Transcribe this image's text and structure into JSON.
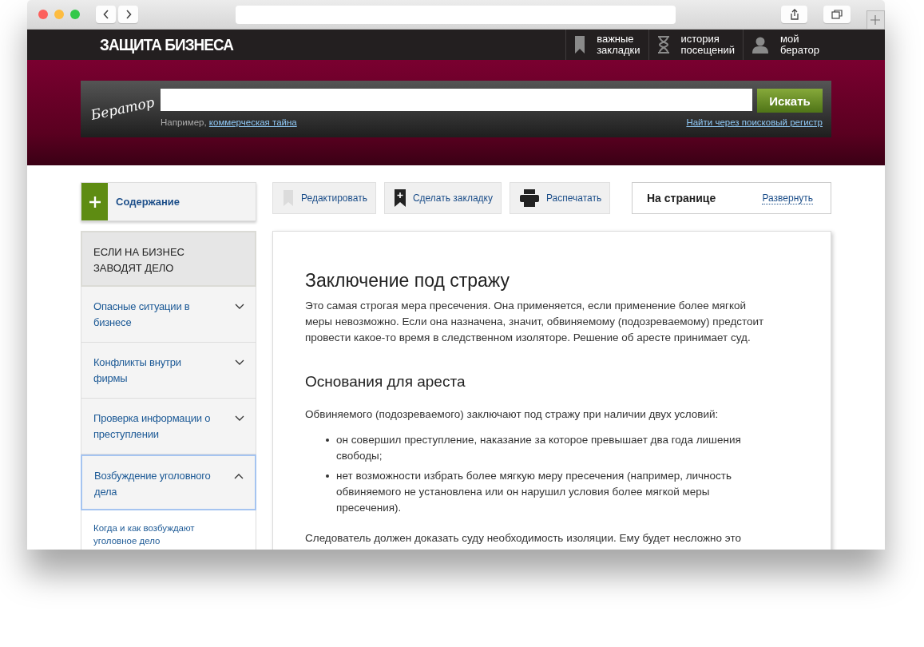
{
  "site_header": {
    "title": "ЗАЩИТА БИЗНЕСА",
    "links": [
      {
        "kind": "bookmarks",
        "lines": [
          "важные",
          "закладки"
        ]
      },
      {
        "kind": "history",
        "lines": [
          "история",
          "посещений"
        ]
      },
      {
        "kind": "profile",
        "lines": [
          "мой",
          "бератор"
        ]
      }
    ]
  },
  "search": {
    "logo_text": "Бератор",
    "button": "Искать",
    "hint_prefix": "Например,",
    "hint_link": "коммерческая тайна",
    "register_link": "Найти через поисковый регистр"
  },
  "toc_button": "Содержание",
  "toolbar": [
    {
      "kind": "edit",
      "label": "Редактировать",
      "disabled": true
    },
    {
      "kind": "bookmark",
      "label": "Сделать закладку",
      "disabled": false
    },
    {
      "kind": "print",
      "label": "Распечатать",
      "disabled": false
    }
  ],
  "on_page": {
    "title": "На странице",
    "link": "Развернуть"
  },
  "sidebar": {
    "section": "ЕСЛИ НА БИЗНЕС ЗАВОДЯТ ДЕЛО",
    "items": [
      {
        "label": "Опасные ситуации в бизнесе",
        "expanded": false,
        "selected": false
      },
      {
        "label": "Конфликты внутри фирмы",
        "expanded": false,
        "selected": false
      },
      {
        "label": "Проверка информации о преступлении",
        "expanded": false,
        "selected": false
      },
      {
        "label": "Возбуждение уголовного дела",
        "expanded": true,
        "selected": true,
        "children": [
          {
            "label": "Когда и как возбуждают уголовное дело"
          }
        ]
      }
    ]
  },
  "article": {
    "title": "Заключение под стражу",
    "intro": "Это самая строгая мера пресечения. Она применяется, если применение более мягкой меры невозможно. Если она назначена, значит, обвиняемому (подозреваемому) предстоит провести какое-то время в следственном изоляторе. Решение об аресте принимает суд.",
    "subtitle": "Основания для ареста",
    "lead": "Обвиняемого (подозреваемого) заключают под стражу при наличии двух условий:",
    "bullets": [
      "он совершил преступление, наказание за которое превышает два года лишения свободы;",
      "нет возможности избрать более мягкую меру пресечения (например, личность обвиняемого не установлена или он нарушил условия более мягкой меры пресечения)."
    ],
    "paragraph": "Следователь должен доказать суду необходимость изоляции. Ему будет несложно это"
  }
}
